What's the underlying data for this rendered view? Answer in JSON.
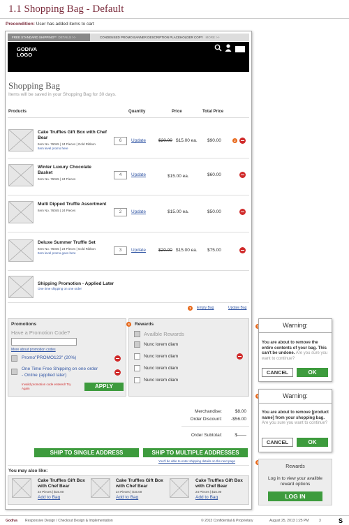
{
  "page": {
    "title": "1.1 Shopping Bag - Default",
    "precondition_label": "Precondition:",
    "precondition_text": " User has added items to cart"
  },
  "promo_banner": {
    "left_text": "FREE STANDARD SHIPPING**",
    "left_more": "DETAILS >>",
    "right_text": "CONDENSED PROMO BANNER DESCRIPTION PLACEHOLDER COPY",
    "right_more": "MORE >>"
  },
  "header": {
    "logo_line1": "GODIVA",
    "logo_line2": "LOGO"
  },
  "bag": {
    "title": "Shopping Bag",
    "subtitle": "Items will be saved in your Shopping Bag for 30 days.",
    "col_products": "Products",
    "col_quantity": "Quantity",
    "col_price": "Price",
    "col_total": "Total Price",
    "update_label": "Update",
    "items": [
      {
        "name": "Cake Truffles Gift Box with Chef Bear",
        "meta": "Item No. 76045  |  24 Pieces  |  Gold Ribbon",
        "promo": "Item level promo here",
        "qty": "6",
        "old_price": "$20.00",
        "price": "$15.00 ea.",
        "total": "$90.00"
      },
      {
        "name": "Winter Luxury Chocolate Basket",
        "meta": "Item No. 76045  |  24 Pieces",
        "promo": "",
        "qty": "4",
        "old_price": "",
        "price": "$15.00 ea.",
        "total": "$60.00"
      },
      {
        "name": "Multi Dipped Truffle Assortment",
        "meta": "Item No. 76045  |  24 Pieces",
        "promo": "",
        "qty": "2",
        "old_price": "",
        "price": "$15.00 ea.",
        "total": "$50.00"
      },
      {
        "name": "Deluxe Summer Truffle Set",
        "meta": "Item No. 76045  |  24 Pieces  |  Gold Ribbon",
        "promo": "Item level promo goes here",
        "qty": "3",
        "old_price": "$20.00",
        "price": "$15.00 ea.",
        "total": "$75.00"
      }
    ],
    "shipping_promo_name": "Shipping Promotion - Applied Later",
    "shipping_promo_sub": "One time shipping on one order",
    "empty_bag": "Empty Bag",
    "update_bag": "Update Bag"
  },
  "promotions": {
    "title": "Promotions",
    "prompt": "Have a Promotion Code?",
    "more_link": "More about promotion codes",
    "applied1": "Promo\"PROMO123\" (20%)",
    "applied2": "One Time Free Shipping on one order - Online (applied later)",
    "error": "Invalid promotion code entered! Try Again",
    "apply_label": "APPLY"
  },
  "rewards": {
    "title": "Rewards",
    "items": [
      "Availble Rewards",
      "Nunc lorem diam",
      "Nunc lorem diam",
      "Nunc lorem diam",
      "Nunc lorem diam"
    ]
  },
  "totals": {
    "merch_label": "Merchandise:",
    "merch_value": "$8.00",
    "discount_label": "Order Discount:",
    "discount_value": "-$56.00",
    "subtotal_label": "Order Subtotal:",
    "subtotal_value": "$——"
  },
  "ship": {
    "single": "SHIP TO  SINGLE ADDRESS",
    "multiple": "SHIP TO  MULTIPLE ADDRESSES",
    "note": "You'll be able to enter shipping details on the next page"
  },
  "also_like": {
    "title": "You may also like:",
    "items": [
      {
        "name": "Cake Truffles Gift Box with Chef Bear",
        "meta": "24 Pieces  |  $15.00",
        "link": "Add to Bag"
      },
      {
        "name": "Cake Truffles Gift Box with Chef Bear",
        "meta": "24 Pieces  |  $15.00",
        "link": "Add to Bag"
      },
      {
        "name": "Cake Truffles Gift Box with Chef Bear",
        "meta": "24 Pieces  |  $15.00",
        "link": "Add to Bag"
      }
    ]
  },
  "annotations": {
    "n1": "1",
    "n2": "2",
    "n3": "3",
    "n4": "4",
    "n5": "5"
  },
  "warning1": {
    "title": "Warning:",
    "bold": "You are about to remove the entire contents of your bag. This can't be undone.",
    "gray": " Are you sure you want to continue?",
    "cancel": "CANCEL",
    "ok": "OK"
  },
  "warning2": {
    "title": "Warning:",
    "bold": "You are about to remove [product name] from your shopping bag.",
    "gray": " Are you sure you want to continue?",
    "cancel": "CANCEL",
    "ok": "OK"
  },
  "rewards_login": {
    "title": "Rewards",
    "text": "Log in to view your availble reward options",
    "button": "LOG IN"
  },
  "footer": {
    "brand": "Godiva",
    "section": "Responsive Design  /  Checkout Design & Implementation",
    "copyright": "© 2013 Confidential & Proprietary",
    "date": "August 25, 2013 1:25 PM",
    "page_num": "3"
  },
  "colors": {
    "accent": "#7a2a3a",
    "green": "#3d9b3d",
    "remove": "#d02b2b",
    "badge": "#e86a1c",
    "link": "#3357a5"
  }
}
